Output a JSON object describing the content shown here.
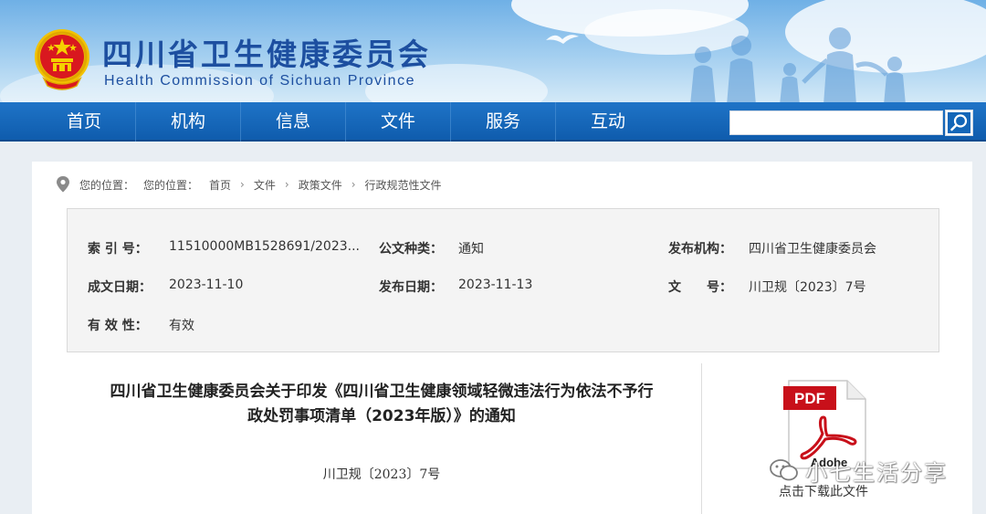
{
  "header": {
    "title_cn": "四川省卫生健康委员会",
    "title_en": "Health Commission of Sichuan Province"
  },
  "nav": {
    "items": [
      "首页",
      "机构",
      "信息",
      "文件",
      "服务",
      "互动"
    ],
    "search_value": ""
  },
  "breadcrumb": {
    "prefix1": "您的位置：",
    "prefix2": "您的位置：",
    "items": [
      "首页",
      "文件",
      "政策文件",
      "行政规范性文件"
    ]
  },
  "meta": {
    "index_label": "索 引 号：",
    "index_value": "11510000MB1528691/2023...",
    "doc_type_label": "公文种类：",
    "doc_type_value": "通知",
    "issuer_label": "发布机构：",
    "issuer_value": "四川省卫生健康委员会",
    "written_date_label": "成文日期：",
    "written_date_value": "2023-11-10",
    "publish_date_label": "发布日期：",
    "publish_date_value": "2023-11-13",
    "doc_no_label": "文　　号：",
    "doc_no_value": "川卫规〔2023〕7号",
    "validity_label": "有 效 性：",
    "validity_value": "有效"
  },
  "document": {
    "title_line1": "四川省卫生健康委员会关于印发《四川省卫生健康领域轻微违法行为依法不予行",
    "title_line2": "政处罚事项清单（2023年版）》的通知",
    "number": "川卫规〔2023〕7号"
  },
  "download": {
    "pdf_label": "PDF",
    "brand_label": "Adobe",
    "text": "点击下载此文件"
  },
  "watermark": {
    "text": "小七生活分享"
  },
  "colors": {
    "nav_blue": "#1366b8",
    "title_blue": "#1d4fa0",
    "pdf_red": "#c8101a"
  }
}
